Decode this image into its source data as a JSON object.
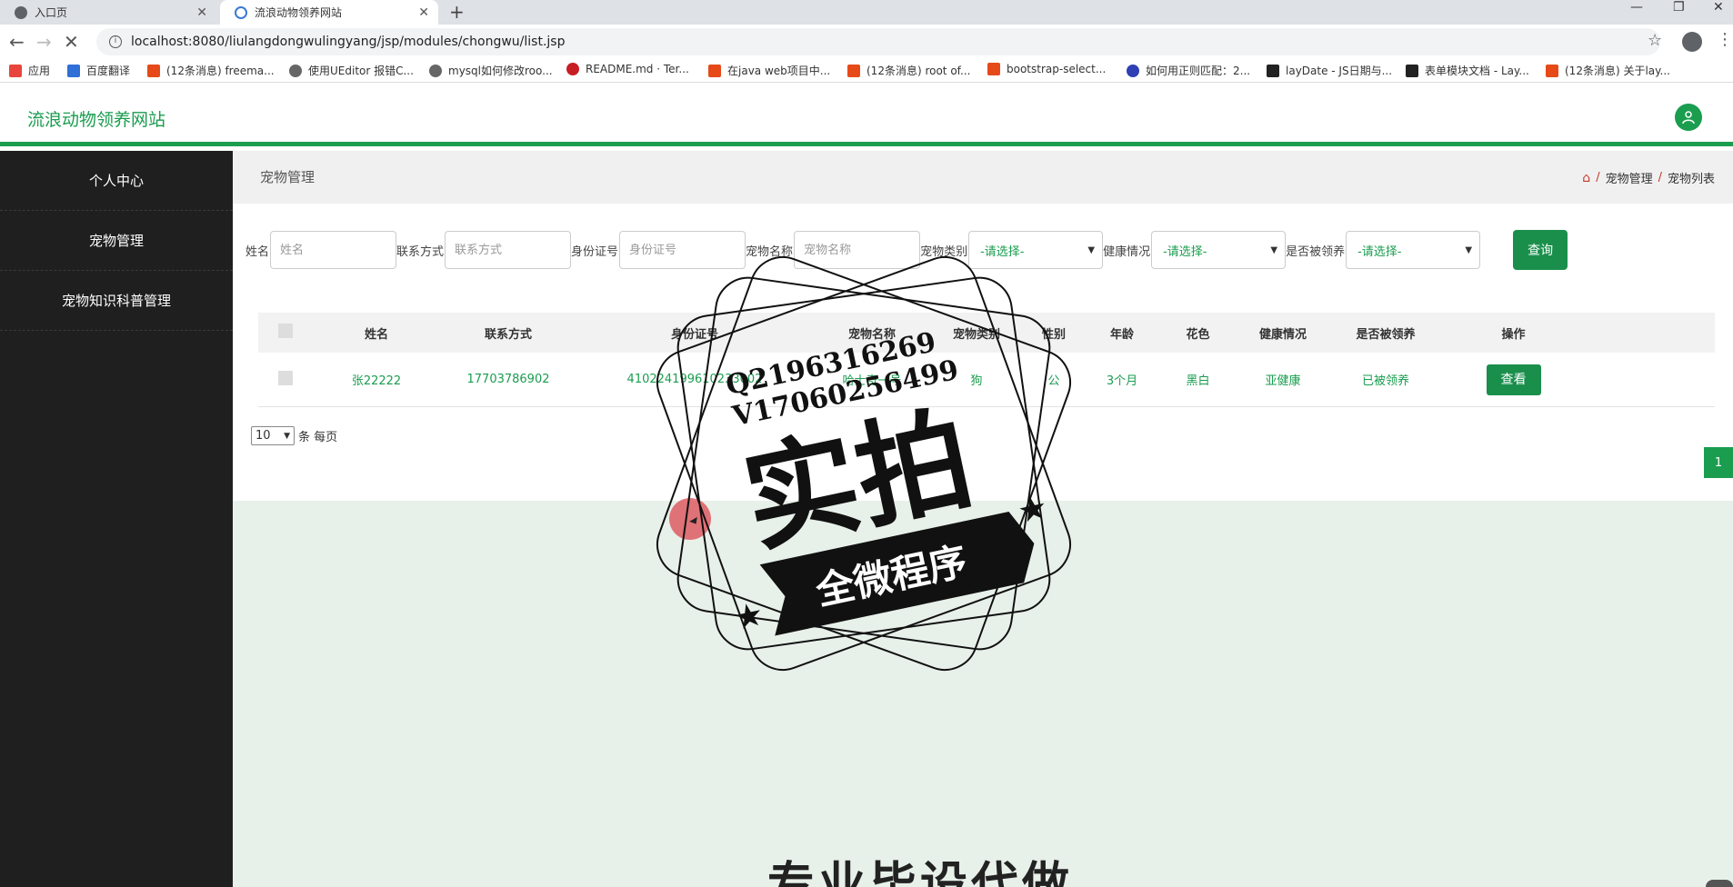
{
  "browser": {
    "tabs": [
      {
        "label": "入口页"
      },
      {
        "label": "流浪动物领养网站"
      }
    ],
    "url": "localhost:8080/liulangdongwulingyang/jsp/modules/chongwu/list.jsp",
    "bookmarks": [
      {
        "label": "应用",
        "icon": "apps-grid-icon",
        "color": "#e8453c"
      },
      {
        "label": "百度翻译",
        "icon": "baidu-translate-icon",
        "color": "#2f6fd6"
      },
      {
        "label": "(12条消息) freema...",
        "icon": "csdn-icon",
        "color": "#e64a19"
      },
      {
        "label": "使用UEditor 报错C...",
        "icon": "generic-site-icon",
        "color": "#555555"
      },
      {
        "label": "mysql如何修改roo...",
        "icon": "generic-site-icon",
        "color": "#555555"
      },
      {
        "label": "README.md · Ter...",
        "icon": "gitee-icon",
        "color": "#c71d23"
      },
      {
        "label": "在java web项目中...",
        "icon": "csdn-icon",
        "color": "#e64a19"
      },
      {
        "label": "(12条消息) root of...",
        "icon": "csdn-icon",
        "color": "#e64a19"
      },
      {
        "label": "bootstrap-select...",
        "icon": "generic-site-icon",
        "color": "#e64a19"
      },
      {
        "label": "如何用正则匹配：2...",
        "icon": "baidu-paw-icon",
        "color": "#2f3fb4"
      },
      {
        "label": "layDate - JS日期与...",
        "icon": "layui-icon",
        "color": "#222222"
      },
      {
        "label": "表单模块文档 - Lay...",
        "icon": "layui-icon",
        "color": "#222222"
      },
      {
        "label": "(12条消息) 关于lay...",
        "icon": "csdn-icon",
        "color": "#e64a19"
      }
    ]
  },
  "app": {
    "title": "流浪动物领养网站",
    "accent": "#1a9d4f"
  },
  "sidebar": {
    "items": [
      {
        "label": "个人中心"
      },
      {
        "label": "宠物管理"
      },
      {
        "label": "宠物知识科普管理"
      }
    ]
  },
  "page": {
    "title": "宠物管理",
    "breadcrumb": [
      "宠物管理",
      "宠物列表"
    ]
  },
  "search": {
    "name_label": "姓名",
    "name_placeholder": "姓名",
    "phone_label": "联系方式",
    "phone_placeholder": "联系方式",
    "idcard_label": "身份证号",
    "idcard_placeholder": "身份证号",
    "petname_label": "宠物名称",
    "petname_placeholder": "宠物名称",
    "type_label": "宠物类别",
    "type_value": "-请选择-",
    "health_label": "健康情况",
    "health_value": "-请选择-",
    "adopted_label": "是否被领养",
    "adopted_value": "-请选择-",
    "submit_label": "查询"
  },
  "table": {
    "headers": [
      "姓名",
      "联系方式",
      "身份证号",
      "宠物名称",
      "宠物类别",
      "性别",
      "年龄",
      "花色",
      "健康情况",
      "是否被领养",
      "操作"
    ],
    "rows": [
      {
        "name": "张22222",
        "phone": "17703786902",
        "idcard": "410224199610233002",
        "petname": "哈士奇一号",
        "type": "狗",
        "sex": "公",
        "age": "3个月",
        "color": "黑白",
        "health": "亚健康",
        "adopted": "已被领养",
        "action": "查看"
      }
    ]
  },
  "pagination": {
    "page_size": "10",
    "page_size_suffix": "条 每页",
    "current_page": "1"
  },
  "overlay": {
    "watermark_line1": "Q2196316269",
    "watermark_line2": "V17060256499",
    "watermark_main": "实拍",
    "watermark_banner": "全微程序",
    "lower_text": "专业毕设代做"
  }
}
